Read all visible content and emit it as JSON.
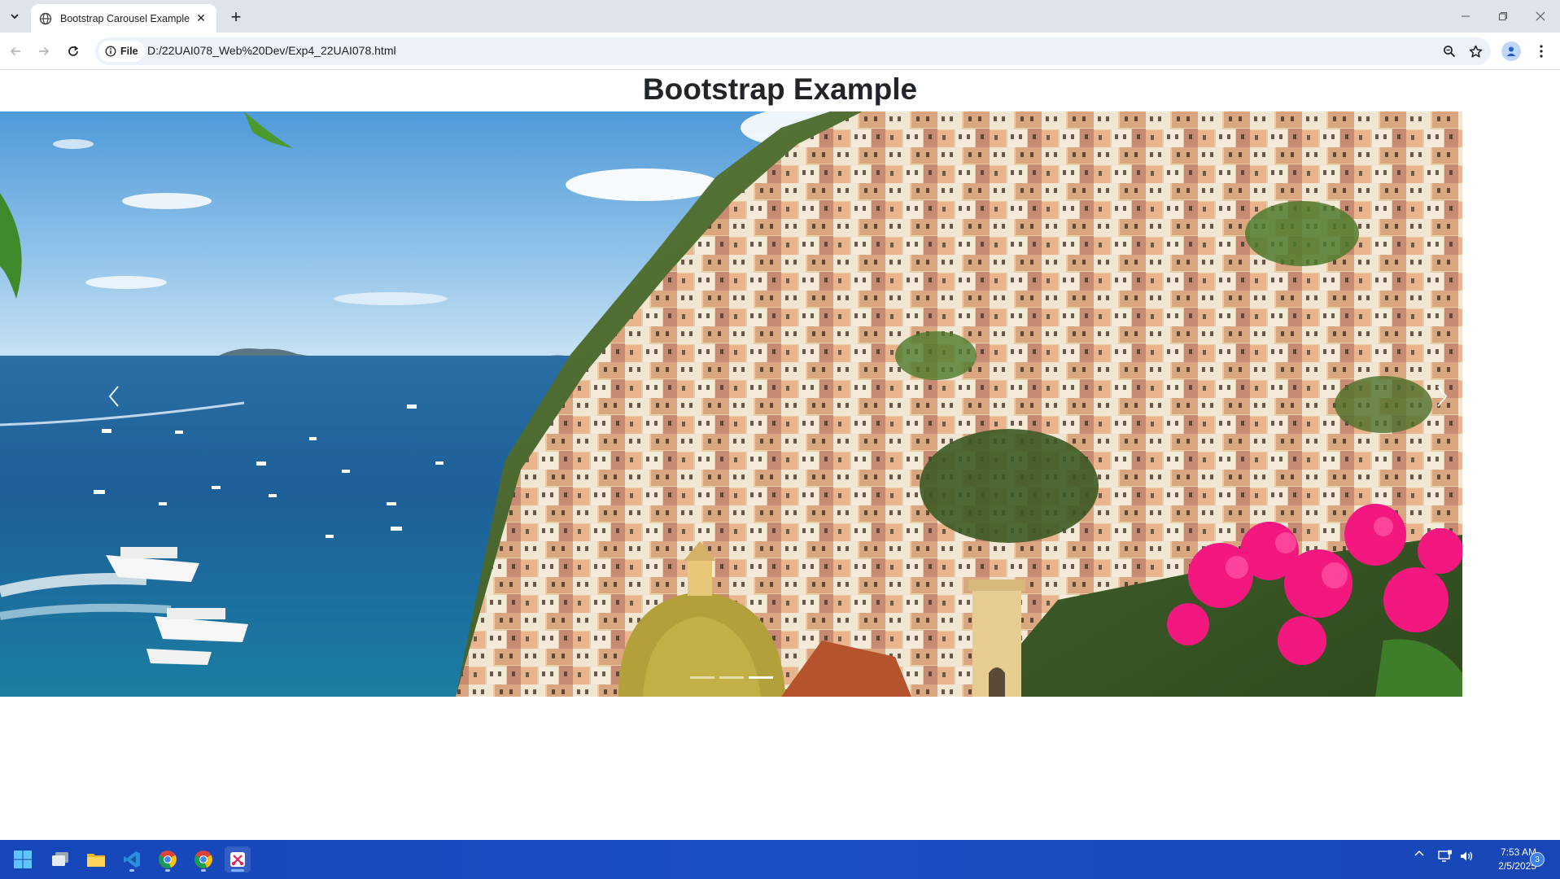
{
  "browser": {
    "tab": {
      "title": "Bootstrap Carousel Example",
      "close": "✕"
    },
    "new_tab": "+",
    "window_controls": {
      "minimize": "—",
      "restore": "❐",
      "close": "✕"
    },
    "address_chip": "File",
    "url": "D:/22UAI078_Web%20Dev/Exp4_22UAI078.html"
  },
  "page": {
    "heading": "Bootstrap Example",
    "carousel": {
      "slide_count": 3,
      "active_index": 2,
      "slide_description": "Positano cliffside village above blue sea with boats and pink bougainvillea",
      "prev_glyph": "‹",
      "next_glyph": "›"
    }
  },
  "taskbar": {
    "apps": [
      "windows-start-icon",
      "file-explorer-icon",
      "folder-icon",
      "vscode-icon",
      "chrome-icon",
      "chrome-icon",
      "snipping-tool-icon"
    ],
    "tray": {
      "chevron": "^"
    },
    "clock": {
      "time": "7:53 AM",
      "date": "2/5/2025"
    },
    "notification_count": "3"
  },
  "colors": {
    "tabstrip": "#dfe3ea",
    "omnibox": "#edf1f9",
    "heading": "#212529",
    "taskbar": "#1a4fc4"
  }
}
